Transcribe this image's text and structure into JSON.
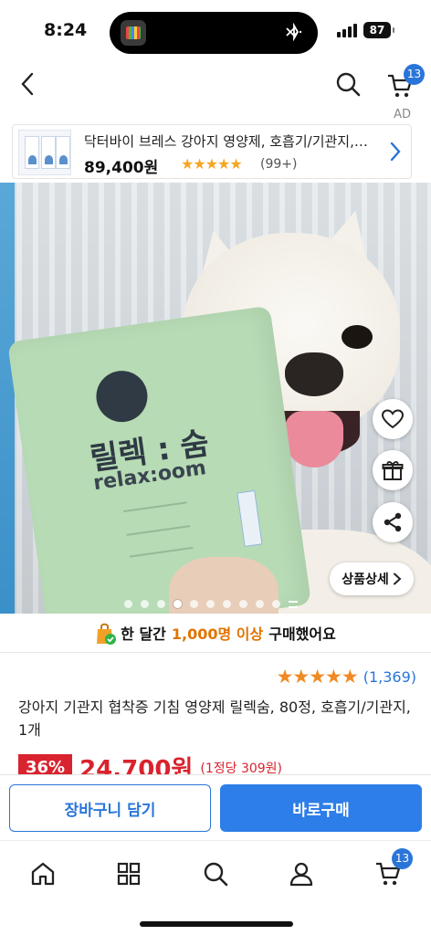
{
  "status_bar": {
    "time": "8:24",
    "battery": "87",
    "icons": [
      "app-icon",
      "bluetooth-icon",
      "signal-icon",
      "battery-icon"
    ]
  },
  "header": {
    "icons": [
      "back-icon",
      "search-icon",
      "cart-icon"
    ],
    "cart_badge": "13",
    "ad_label": "AD"
  },
  "ad_banner": {
    "title": "닥터바이 브레스 강아지 영양제, 호흡기/기관지,…",
    "price": "89,400원",
    "stars": "★★★★★",
    "rating": 4.5,
    "review_count": "(99+)",
    "thumb_text": "BREATH"
  },
  "hero": {
    "pouch_brand": "릴렉 : 숨",
    "pouch_brand_en": "relax:oom",
    "detail_button": "상품상세",
    "side_icons": [
      "heart-icon",
      "gift-icon",
      "share-icon"
    ],
    "page_count": 10,
    "current_page": 4
  },
  "social_proof": {
    "prefix": "한 달간",
    "highlight": "1,000명 이상",
    "suffix": "구매했어요"
  },
  "product": {
    "stars": "★★★★★",
    "rating": 5,
    "review_count": "(1,369)",
    "title": "강아지 기관지 협착증 기침 영양제 릴렉숨, 80정, 호흡기/기관지, 1개",
    "discount": "36%",
    "sale_price": "24,700원",
    "unit_price": "(1정당 309원)"
  },
  "buy_bar": {
    "cart_label": "장바구니 담기",
    "buy_label": "바로구매"
  },
  "tab_bar": {
    "icons": [
      "home-icon",
      "category-icon",
      "search-icon",
      "profile-icon",
      "cart-icon"
    ],
    "cart_badge": "13"
  },
  "colors": {
    "accent": "#2a75d9",
    "sale": "#d9232e",
    "star": "#f08a24",
    "highlight": "#e07400"
  }
}
